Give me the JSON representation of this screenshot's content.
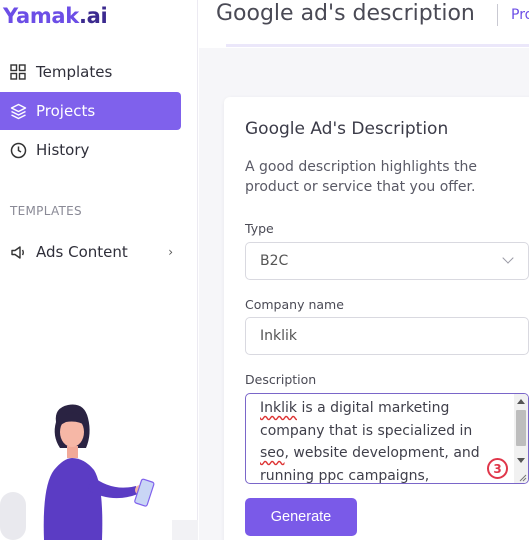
{
  "app": {
    "brand": "Yamak",
    "tld": ".ai"
  },
  "sidebar": {
    "items": [
      {
        "label": "Templates",
        "icon": "grid-icon"
      },
      {
        "label": "Projects",
        "icon": "layers-icon",
        "active": true
      },
      {
        "label": "History",
        "icon": "clock-icon"
      }
    ],
    "section_title": "TEMPLATES",
    "templates": [
      {
        "label": "Ads Content",
        "icon": "megaphone-icon"
      }
    ]
  },
  "header": {
    "title": "Google ad's description",
    "link": "Pro"
  },
  "form": {
    "title": "Google Ad's Description",
    "description": "A good description highlights the product or service that you offer.",
    "type_label": "Type",
    "type_value": "B2C",
    "company_label": "Company name",
    "company_value": "Inklik",
    "desc_label": "Description",
    "desc_value": {
      "w1": "Inklik",
      "w2": " is a digital marketing company that is specialized in ",
      "w3": "seo",
      "w4": ", website development, and running ",
      "w5": "ppc",
      "w6": " campaigns,"
    },
    "badge": "3",
    "generate_label": "Generate"
  },
  "colors": {
    "accent": "#7a5ae8",
    "active_nav": "#7f61ec",
    "badge": "#e0364a"
  }
}
